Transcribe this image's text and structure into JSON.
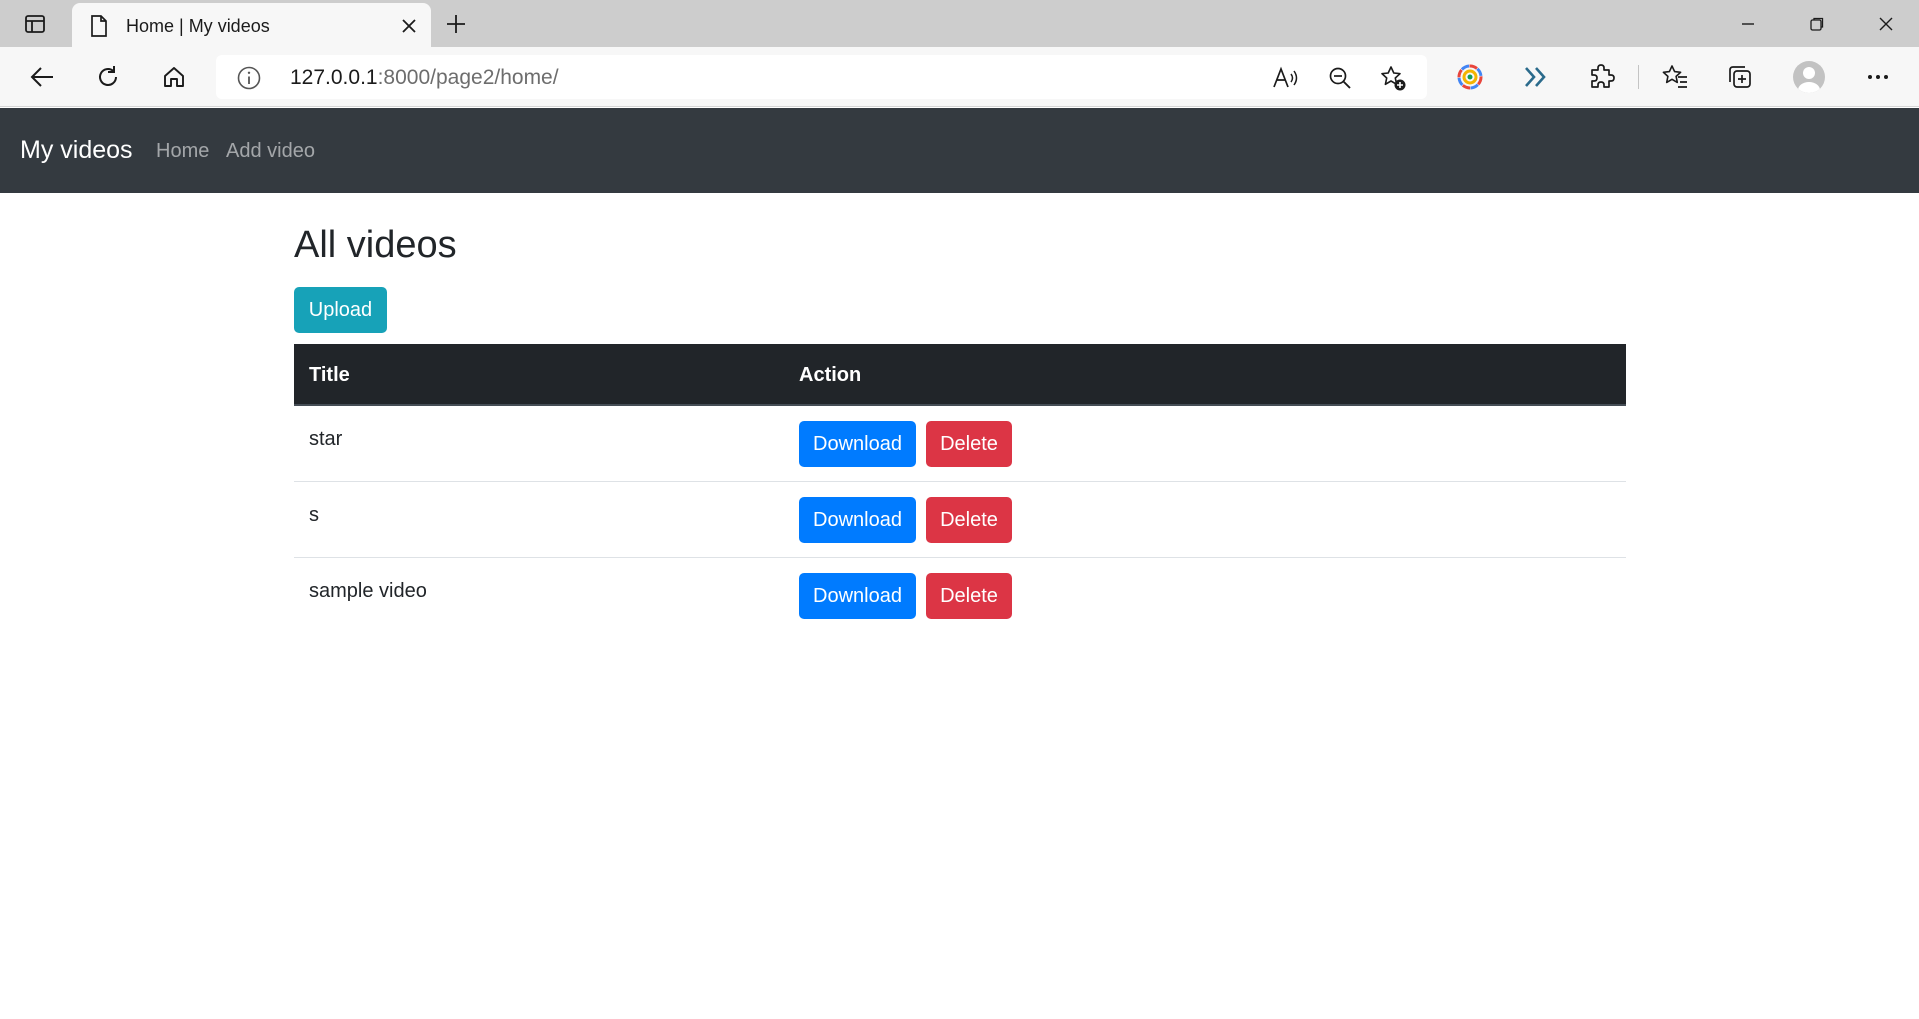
{
  "browser": {
    "tab": {
      "title": "Home | My videos"
    },
    "address": {
      "host": "127.0.0.1",
      "rest": ":8000/page2/home/"
    }
  },
  "navbar": {
    "brand": "My videos",
    "links": [
      {
        "label": "Home"
      },
      {
        "label": "Add video"
      }
    ]
  },
  "main": {
    "heading": "All videos",
    "upload_label": "Upload",
    "table": {
      "headers": [
        "Title",
        "Action"
      ],
      "rows": [
        {
          "title": "star",
          "download_label": "Download",
          "delete_label": "Delete"
        },
        {
          "title": "s",
          "download_label": "Download",
          "delete_label": "Delete"
        },
        {
          "title": "sample video",
          "download_label": "Download",
          "delete_label": "Delete"
        }
      ]
    }
  },
  "colors": {
    "navbar": "#343a40",
    "info": "#17a2b8",
    "primary": "#007bff",
    "danger": "#dc3545",
    "table_head": "#212529"
  }
}
